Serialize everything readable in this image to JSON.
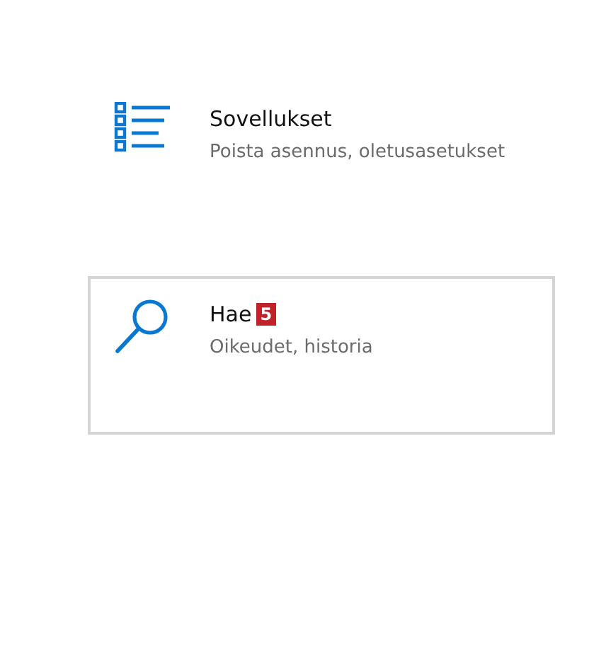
{
  "tiles": [
    {
      "kind": "apps",
      "title": "Sovellukset",
      "subtitle": "Poista asennus, oletusasetukset",
      "selected": false
    },
    {
      "kind": "search",
      "title": "Hae",
      "badge": "5",
      "subtitle": "Oikeudet, historia",
      "selected": true
    }
  ]
}
